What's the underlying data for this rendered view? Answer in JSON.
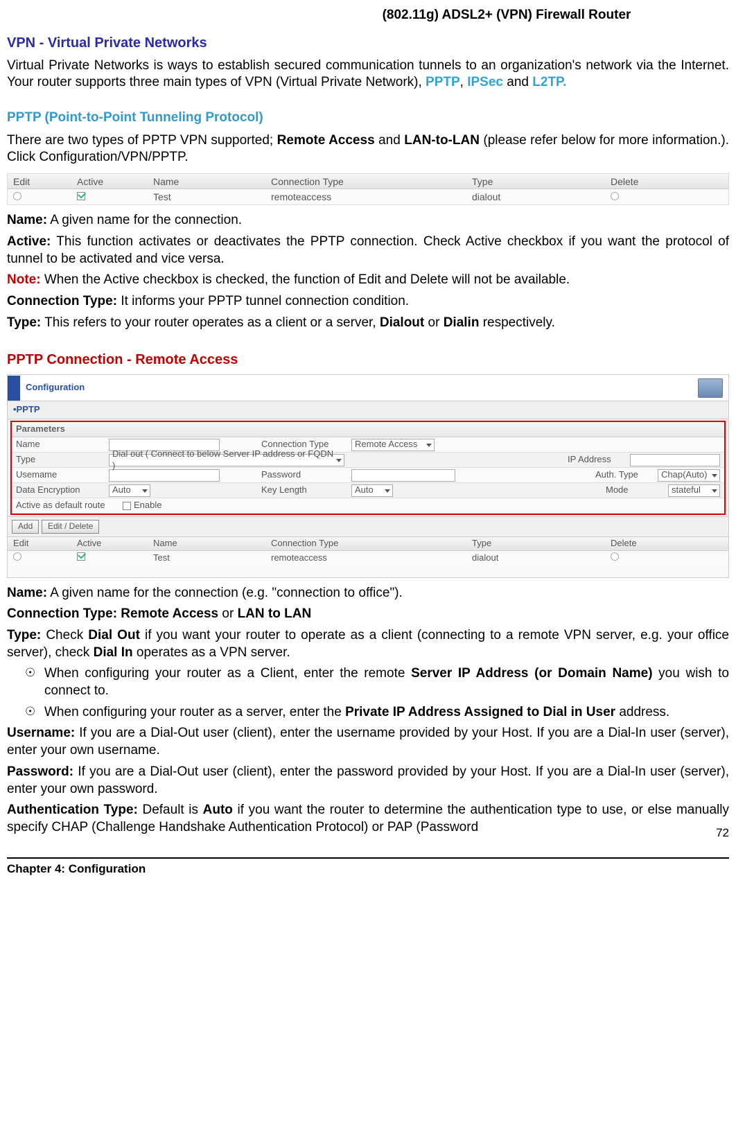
{
  "header": {
    "title": "(802.11g) ADSL2+ (VPN) Firewall Router"
  },
  "section1": {
    "title": "VPN - Virtual Private Networks",
    "p1a": "Virtual Private Networks is ways to establish secured communication tunnels to an organization's network via the Internet. Your router supports three main types of VPN (Virtual Private Network), ",
    "kw1": "PPTP",
    "sep1": ", ",
    "kw2": "IPSec",
    "p1b": " and ",
    "kw3": "L2TP.",
    "subtitle": "PPTP (Point-to-Point Tunneling Protocol)",
    "p2a": "There are two types of PPTP VPN supported; ",
    "b2a": "Remote Access",
    "p2b": " and ",
    "b2b": "LAN-to-LAN",
    "p2c": " (please refer below for more information.). Click Configuration/VPN/PPTP."
  },
  "table1": {
    "headers": {
      "edit": "Edit",
      "active": "Active",
      "name": "Name",
      "conn": "Connection Type",
      "type": "Type",
      "del": "Delete"
    },
    "row": {
      "name": "Test",
      "conn": "remoteaccess",
      "type": "dialout"
    }
  },
  "defs": {
    "name_l": "Name:",
    "name_t": " A given name for the connection.",
    "active_l": "Active:",
    "active_t": " This function activates or deactivates the PPTP connection.  Check Active checkbox if you want the protocol of tunnel to be activated and vice versa.",
    "note_l": "Note:",
    "note_t": " When the Active checkbox is checked, the function of Edit and Delete will not be available.",
    "conn_l": "Connection Type:",
    "conn_t": " It informs your PPTP tunnel connection condition.",
    "type_l": "Type:",
    "type_t1": " This refers to your router operates as a client or a server, ",
    "type_b1": "Dialout",
    "type_t2": " or ",
    "type_b2": "Dialin",
    "type_t3": " respectively."
  },
  "section2": {
    "title": "PPTP Connection - Remote Access"
  },
  "panel": {
    "conf": "Configuration",
    "tab": "•PPTP",
    "params": "Parameters",
    "l_name": "Name",
    "l_conn": "Connection Type",
    "v_conn": "Remote Access",
    "l_type": "Type",
    "v_type": "Dial out ( Connect to below Server IP address or FQDN )",
    "l_ip": "IP Address",
    "l_user": "Usemame",
    "l_pass": "Password",
    "l_auth": "Auth. Type",
    "v_auth": "Chap(Auto)",
    "l_enc": "Data Encryption",
    "v_enc": "Auto",
    "l_key": "Key Length",
    "v_key": "Auto",
    "l_mode": "Mode",
    "v_mode": "stateful",
    "l_def": "Active as default route",
    "l_enable": "Enable",
    "btn_add": "Add",
    "btn_ed": "Edit / Delete",
    "hdr": {
      "edit": "Edit",
      "active": "Active",
      "name": "Name",
      "conn": "Connection Type",
      "type": "Type",
      "del": "Delete"
    },
    "row": {
      "name": "Test",
      "conn": "remoteaccess",
      "type": "dialout"
    }
  },
  "defs2": {
    "name_l": "Name:",
    "name_t": " A given name for the connection (e.g. \"connection to office\").",
    "conn_l": "Connection Type: Remote Access",
    "conn_m": " or ",
    "conn_r": "LAN to LAN",
    "type_l": "Type:",
    "type_t1": " Check ",
    "type_b1": "Dial Out",
    "type_t2": " if you want your router to operate as a client (connecting to a remote VPN server, e.g. your office server), check ",
    "type_b2": "Dial In",
    "type_t3": " operates as a VPN server.",
    "bul1a": "When configuring your router as a Client, enter the remote ",
    "bul1b": "Server IP Address (or Domain Name)",
    "bul1c": " you wish to connect to.",
    "bul2a": "When configuring your router as a server, enter the ",
    "bul2b": "Private IP Address Assigned to Dial in User",
    "bul2c": " address.",
    "user_l": "Username:",
    "user_t": " If you are a Dial-Out user (client), enter the username provided by your Host.   If you are a Dial-In user (server), enter your own username.",
    "pass_l": "Password:",
    "pass_t": " If you are a Dial-Out user (client), enter the password provided by your Host.   If you are a Dial-In user (server), enter your own password.",
    "auth_l": "Authentication Type:",
    "auth_t1": " Default is ",
    "auth_b1": "Auto",
    "auth_t2": " if you want the router to determine the authentication type to use, or else manually specify CHAP (Challenge Handshake Authentication Protocol) or PAP (Password"
  },
  "footer": {
    "chapter": "Chapter 4: Configuration",
    "page": "72"
  }
}
